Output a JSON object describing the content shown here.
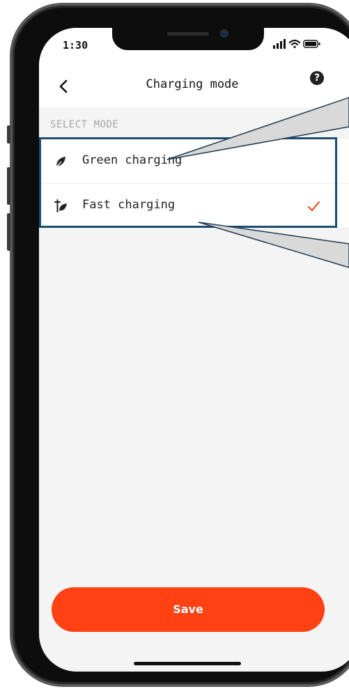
{
  "status_bar": {
    "time": "1:30"
  },
  "header": {
    "title": "Charging mode",
    "back_icon": "chevron-left-icon",
    "help_icon": "question-circle-icon",
    "help_glyph": "?"
  },
  "section": {
    "label": "SELECT MODE"
  },
  "options": [
    {
      "label": "Green charging",
      "icon": "leaf-icon",
      "selected": false
    },
    {
      "label": "Fast charging",
      "icon": "fast-charge-icon",
      "selected": true
    }
  ],
  "save": {
    "label": "Save"
  },
  "colors": {
    "accent": "#ff4114",
    "check": "#ff4114",
    "highlight": "#1d4d6e",
    "callout_fill": "#d9d9d9"
  }
}
